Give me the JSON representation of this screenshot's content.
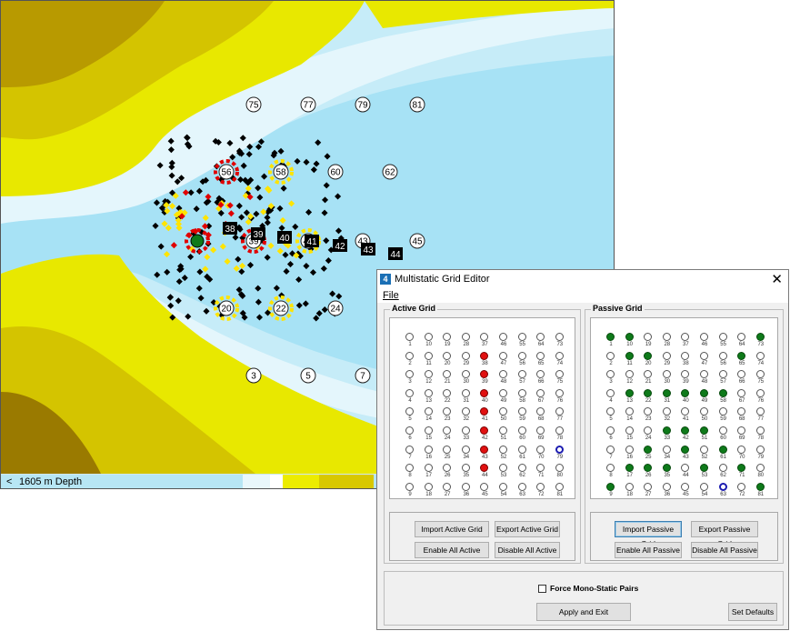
{
  "map": {
    "status_arrow": "<",
    "depth_label": "1605 m Depth",
    "colors": {
      "deep_water": "#a7e2f5",
      "mid_water": "#c6ecf8",
      "shallow": "#e4f6fc",
      "land_low": "#e8e800",
      "land_mid": "#d4c400",
      "land_high": "#b89a00",
      "land_peak": "#9a7a00"
    },
    "circle_labels": [
      "75",
      "77",
      "79",
      "81",
      "56",
      "58",
      "60",
      "62",
      "38",
      "39",
      "40",
      "41",
      "42",
      "43",
      "44",
      "45",
      "20",
      "22",
      "24",
      "3",
      "5",
      "7"
    ],
    "black_labels": [
      "38",
      "39",
      "40",
      "41",
      "42",
      "43",
      "44"
    ],
    "grid_nodes": [
      {
        "label": "75",
        "style": "white"
      },
      {
        "label": "77",
        "style": "white"
      },
      {
        "label": "79",
        "style": "white"
      },
      {
        "label": "81",
        "style": "white"
      },
      {
        "label": "56",
        "style": "red"
      },
      {
        "label": "58",
        "style": "yellow"
      },
      {
        "label": "60",
        "style": "white"
      },
      {
        "label": "62",
        "style": "white"
      },
      {
        "label": "39",
        "style": "red"
      },
      {
        "label": "41",
        "style": "yellow"
      },
      {
        "label": "43",
        "style": "white"
      },
      {
        "label": "45",
        "style": "white"
      },
      {
        "label": "20",
        "style": "yellow"
      },
      {
        "label": "22",
        "style": "yellow"
      },
      {
        "label": "24",
        "style": "white"
      },
      {
        "label": "3",
        "style": "white"
      },
      {
        "label": "5",
        "style": "white"
      },
      {
        "label": "7",
        "style": "white"
      }
    ],
    "black_tags": [
      "38",
      "39",
      "40",
      "41",
      "42",
      "43",
      "44"
    ]
  },
  "dialog": {
    "title": "Multistatic Grid Editor",
    "close_label": "✕",
    "menu_file": "File",
    "active_title": "Active Grid",
    "passive_title": "Passive Grid",
    "import_active": "Import Active Grid",
    "export_active": "Export Active Grid",
    "enable_active": "Enable All Active",
    "disable_active": "Disable All Active",
    "import_passive": "Import Passive Grid",
    "export_passive": "Export Passive Grid",
    "enable_passive": "Enable All Passive",
    "disable_passive": "Disable All Passive",
    "force_mono": "Force Mono-Static Pairs",
    "apply_exit": "Apply and Exit",
    "set_defaults": "Set Defaults",
    "rows": 9,
    "cols": 9,
    "active_red": [
      38,
      39,
      40,
      41,
      42,
      43,
      44
    ],
    "active_blue": [
      79
    ],
    "passive_green": [
      1,
      10,
      11,
      20,
      22,
      31,
      40,
      49,
      58,
      65,
      73,
      33,
      42,
      51,
      13,
      25,
      43,
      61,
      71,
      17,
      26,
      35,
      53,
      9,
      81
    ],
    "passive_blue": [
      63
    ]
  }
}
